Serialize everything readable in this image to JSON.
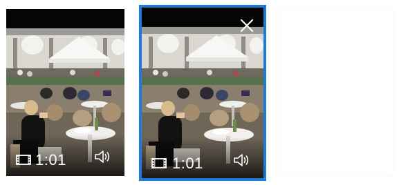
{
  "thumbnails": [
    {
      "duration": "1:01",
      "icons": {
        "type": "film-icon",
        "audio": "speaker-icon"
      },
      "selected": false
    },
    {
      "duration": "1:01",
      "icons": {
        "type": "film-icon",
        "audio": "speaker-icon",
        "close": "close-icon"
      },
      "selected": true
    }
  ],
  "colors": {
    "selection_border": "#1e7bd8",
    "overlay_text": "#ffffff",
    "background": "#ffffff"
  }
}
